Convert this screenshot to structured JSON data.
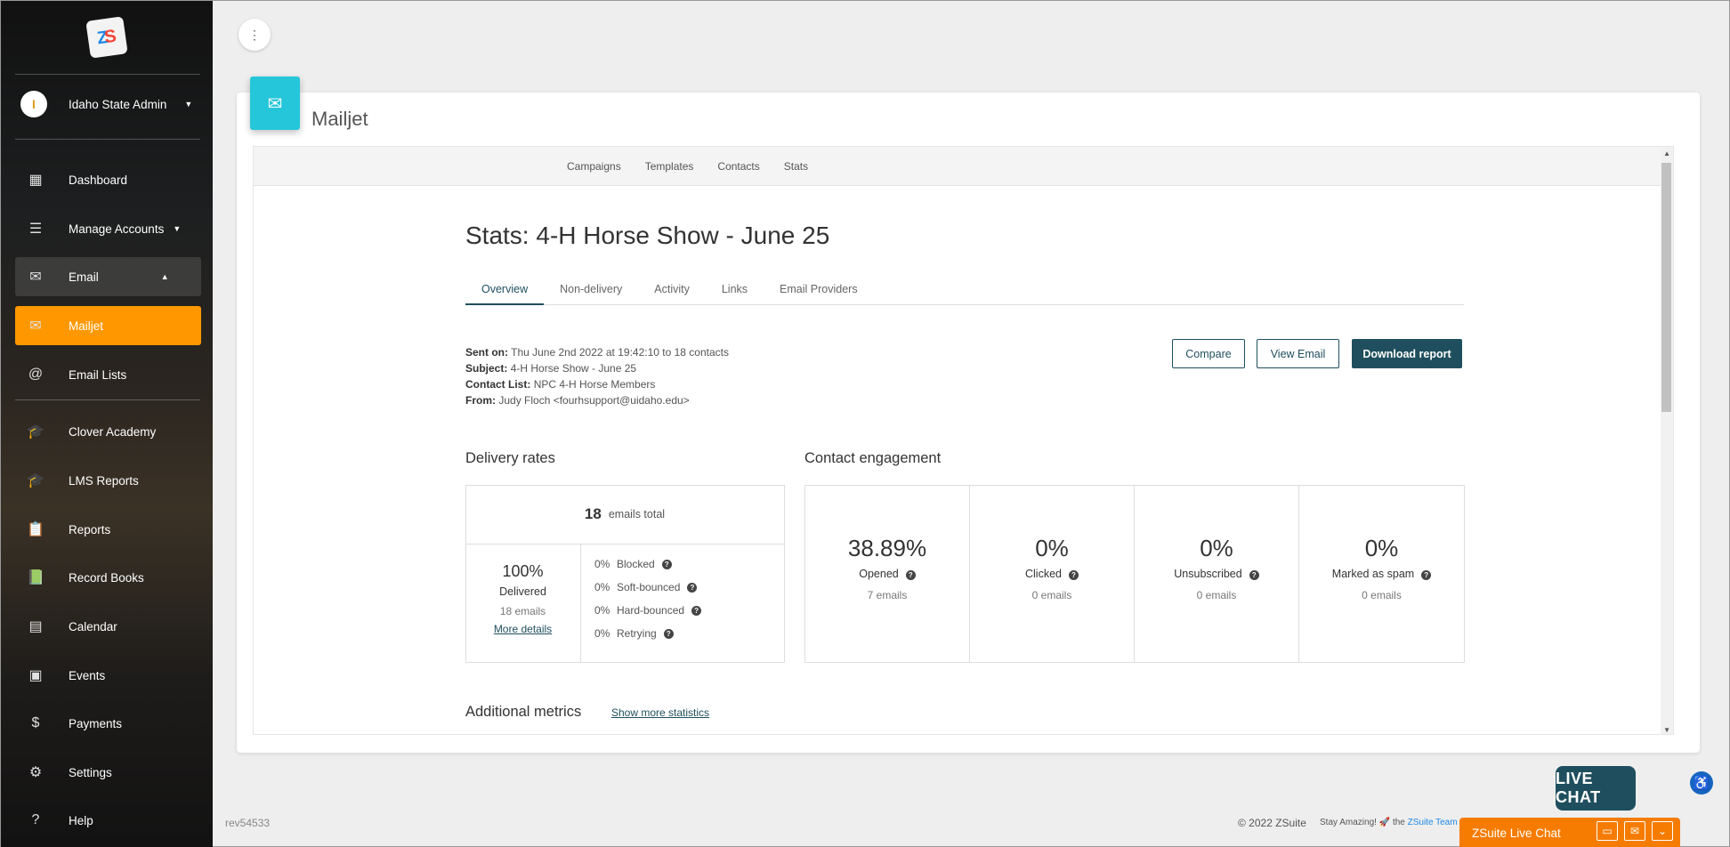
{
  "sidebar": {
    "logo": "ZS",
    "user": {
      "name": "Idaho State Admin"
    },
    "items": [
      {
        "label": "Dashboard",
        "icon": "dashboard-icon"
      },
      {
        "label": "Manage Accounts",
        "icon": "list-icon"
      },
      {
        "label": "Email",
        "icon": "mail-icon"
      },
      {
        "label": "Mailjet",
        "icon": "open-mail-icon"
      },
      {
        "label": "Email Lists",
        "icon": "at-icon"
      },
      {
        "label": "Clover Academy",
        "icon": "graduation-cap-icon"
      },
      {
        "label": "LMS Reports",
        "icon": "graduation-cap-icon"
      },
      {
        "label": "Reports",
        "icon": "clipboard-icon"
      },
      {
        "label": "Record Books",
        "icon": "record-books-icon"
      },
      {
        "label": "Calendar",
        "icon": "calendar-icon"
      },
      {
        "label": "Events",
        "icon": "event-icon"
      },
      {
        "label": "Payments",
        "icon": "dollar-icon"
      },
      {
        "label": "Settings",
        "icon": "gear-icon"
      },
      {
        "label": "Help",
        "icon": "help-icon"
      }
    ],
    "active_color": "#ff9800"
  },
  "page": {
    "title": "Mailjet",
    "topnav": [
      "Campaigns",
      "Templates",
      "Contacts",
      "Stats"
    ],
    "stats_title": "Stats: 4-H Horse Show - June 25",
    "tabs": [
      "Overview",
      "Non-delivery",
      "Activity",
      "Links",
      "Email Providers"
    ],
    "meta": {
      "sent_on_label": "Sent on:",
      "sent_on": "Thu June 2nd 2022 at 19:42:10 to 18 contacts",
      "subject_label": "Subject:",
      "subject": "4-H Horse Show - June 25",
      "contact_list_label": "Contact List:",
      "contact_list": "NPC 4-H Horse Members",
      "from_label": "From:",
      "from": "Judy Floch <fourhsupport@uidaho.edu>"
    },
    "buttons": {
      "compare": "Compare",
      "view_email": "View Email",
      "download": "Download report"
    },
    "delivery": {
      "title": "Delivery rates",
      "total": "18",
      "total_label": "emails total",
      "delivered_pct": "100%",
      "delivered_label": "Delivered",
      "delivered_sub": "18 emails",
      "more": "More details",
      "rows": [
        {
          "pct": "0%",
          "label": "Blocked"
        },
        {
          "pct": "0%",
          "label": "Soft-bounced"
        },
        {
          "pct": "0%",
          "label": "Hard-bounced"
        },
        {
          "pct": "0%",
          "label": "Retrying"
        }
      ]
    },
    "engagement": {
      "title": "Contact engagement",
      "cells": [
        {
          "value": "38.89%",
          "label": "Opened",
          "sub": "7 emails"
        },
        {
          "value": "0%",
          "label": "Clicked",
          "sub": "0 emails"
        },
        {
          "value": "0%",
          "label": "Unsubscribed",
          "sub": "0 emails"
        },
        {
          "value": "0%",
          "label": "Marked as spam",
          "sub": "0 emails"
        }
      ]
    },
    "additional": {
      "title": "Additional metrics",
      "link": "Show more statistics"
    }
  },
  "footer": {
    "rev": "rev54533",
    "copyright": "© 2022 ZSuite",
    "stay": "Stay Amazing!",
    "the": "the",
    "team": "ZSuite Team",
    "live_chat_bubble": "LIVE CHAT",
    "live_chat_bar": "ZSuite Live Chat"
  }
}
